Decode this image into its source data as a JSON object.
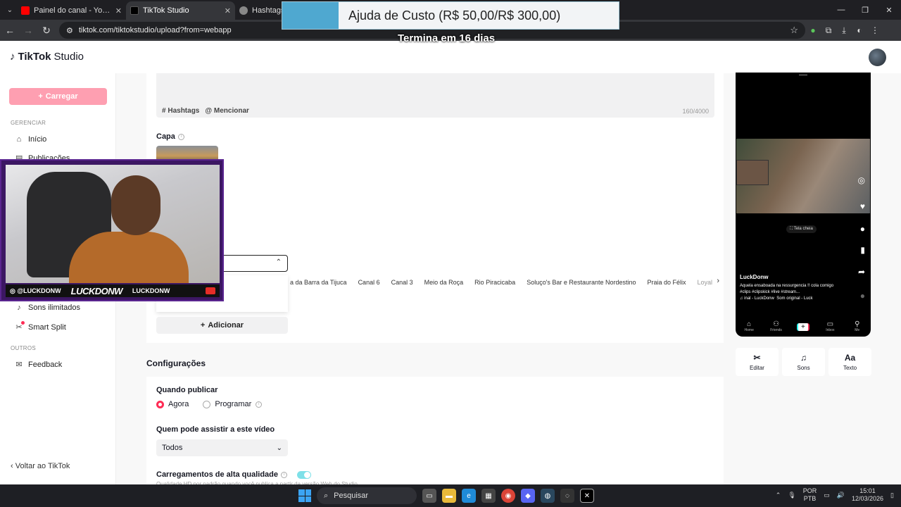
{
  "browser": {
    "tabs": [
      {
        "title": "Painel do canal - YouTube Studio",
        "color": "#ff0000",
        "active": false
      },
      {
        "title": "TikTok Studio",
        "color": "#000000",
        "active": true
      },
      {
        "title": "Hashtags",
        "color": "#888888",
        "active": false
      }
    ],
    "url": "tiktok.com/tiktokstudio/upload?from=webapp"
  },
  "overlay": {
    "banner": "Ajuda de Custo (R$ 50,00/R$ 300,00)",
    "subtitle": "Termina em 16 dias"
  },
  "header": {
    "logo_brand": "TikTok",
    "logo_product": "Studio"
  },
  "sidebar": {
    "upload_label": "Carregar",
    "manage_label": "GERENCIAR",
    "items": [
      {
        "label": "Início",
        "icon": "home-icon"
      },
      {
        "label": "Publicações",
        "icon": "posts-icon"
      },
      {
        "label": "Sons ilimitados",
        "icon": "music-icon"
      },
      {
        "label": "Smart Split",
        "icon": "split-icon"
      }
    ],
    "others_label": "OUTROS",
    "feedback_label": "Feedback",
    "back_label": "Voltar ao TikTok"
  },
  "description": {
    "hashtags_label": "Hashtags",
    "mention_label": "Mencionar",
    "count": "160/4000"
  },
  "cover": {
    "label": "Capa"
  },
  "location": {
    "chips": [
      "a da Barra da Tijuca",
      "Canal 6",
      "Canal 3",
      "Meio da Roça",
      "Rio Piracicaba",
      "Soluço's Bar e Restaurante Nordestino",
      "Praia do Félix",
      "Loyalty"
    ],
    "add_label": "Adicionar"
  },
  "settings": {
    "title": "Configurações",
    "when_label": "Quando publicar",
    "now_label": "Agora",
    "schedule_label": "Programar",
    "who_label": "Quem pode assistir a este vídeo",
    "who_value": "Todos",
    "hq_label": "Carregamentos de alta qualidade",
    "hq_sub": "Qualidade HD por padrão quando você publica a partir da versão Web do Studio"
  },
  "preview": {
    "fullscreen": "Tela cheia",
    "username": "LuckDonw",
    "caption": "Aquela ensaboada na ressurgencia !! cola comigo #clips #clipskick #live #stream...",
    "music_1": "♫ inal - LuckDonw",
    "music_2": "Som original - Luck",
    "nav": [
      "Home",
      "Friends",
      "Inbox",
      "Me"
    ]
  },
  "tools": [
    {
      "label": "Editar",
      "icon": "scissors-icon"
    },
    {
      "label": "Sons",
      "icon": "music-note-icon"
    },
    {
      "label": "Texto",
      "icon": "text-icon",
      "glyph": "Aa"
    }
  ],
  "webcam": {
    "handle": "@LUCKDONW",
    "name_big": "LUCKDONW",
    "name_small": "LUCKDONW"
  },
  "taskbar": {
    "search": "Pesquisar",
    "lang_1": "POR",
    "lang_2": "PTB",
    "time": "15:01",
    "date": "12/03/2026"
  }
}
